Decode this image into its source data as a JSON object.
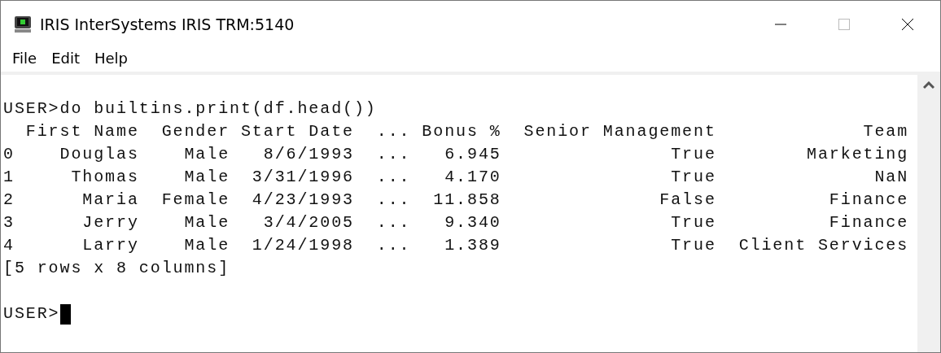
{
  "window": {
    "title": "IRIS InterSystems IRIS TRM:5140"
  },
  "menu": [
    {
      "label": "File"
    },
    {
      "label": "Edit"
    },
    {
      "label": "Help"
    }
  ],
  "terminal": {
    "lines": [
      "USER>do builtins.print(df.head())",
      "  First Name  Gender Start Date  ... Bonus %  Senior Management             Team",
      "0    Douglas    Male   8/6/1993  ...   6.945               True        Marketing",
      "1     Thomas    Male  3/31/1996  ...   4.170               True              NaN",
      "2      Maria  Female  4/23/1993  ...  11.858              False          Finance",
      "3      Jerry    Male   3/4/2005  ...   9.340               True          Finance",
      "4      Larry    Male  1/24/1998  ...   1.389               True  Client Services",
      "[5 rows x 8 columns]"
    ],
    "prompt": "USER>"
  }
}
